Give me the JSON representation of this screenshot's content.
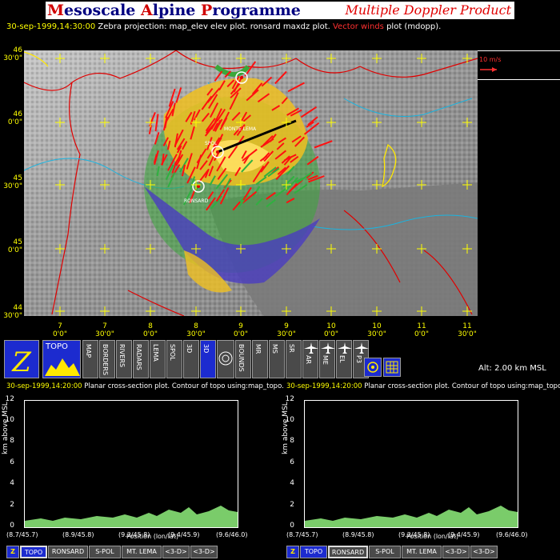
{
  "title": {
    "left_parts": [
      {
        "cap": "M",
        "rest": "esoscale "
      },
      {
        "cap": "A",
        "rest": "lpine "
      },
      {
        "cap": "P",
        "rest": "rogramme"
      }
    ],
    "right": "Multiple Doppler Product"
  },
  "info": {
    "datetime": "30-sep-1999,14:30:00",
    "prefix": "Zebra projection: map_elev elev plot. ronsard maxdz plot. ",
    "vector": "Vector winds",
    "suffix": " plot (mdopp)."
  },
  "map": {
    "wind_scale_label": "10 m/s",
    "left_ticks": [
      {
        "deg": "46",
        "min": "30'0\""
      },
      {
        "deg": "46",
        "min": "0'0\""
      },
      {
        "deg": "45",
        "min": "30'0\""
      },
      {
        "deg": "45",
        "min": "0'0\""
      },
      {
        "deg": "44",
        "min": "30'0\""
      }
    ],
    "bottom_ticks": [
      {
        "deg": "7",
        "min": "0'0\""
      },
      {
        "deg": "7",
        "min": "30'0\""
      },
      {
        "deg": "8",
        "min": "0'0\""
      },
      {
        "deg": "8",
        "min": "30'0\""
      },
      {
        "deg": "9",
        "min": "0'0\""
      },
      {
        "deg": "9",
        "min": "30'0\""
      },
      {
        "deg": "10",
        "min": "0'0\""
      },
      {
        "deg": "10",
        "min": "30'0\""
      },
      {
        "deg": "11",
        "min": "0'0\""
      },
      {
        "deg": "11",
        "min": "30'0\""
      }
    ],
    "radar_labels": [
      "SPOL",
      "MONTE LEMA",
      "RONSARD"
    ],
    "colors": {
      "terrain": "#8c8c8c",
      "border": "#e00000",
      "water": "#1ab4e0",
      "lake": "#ffe800",
      "wind": "#ff0000"
    }
  },
  "toolbar": {
    "z_label": "Z",
    "topo_label": "TOPO",
    "items": [
      "MAP",
      "BORDERS",
      "RIVERS",
      "RADARS",
      "LEMA",
      "SPOL",
      "3D",
      "3D",
      "",
      "BOUNDS",
      "MR",
      "MS",
      "SR",
      "AR",
      "ME",
      "EL",
      "P3"
    ],
    "altitude": "Alt: 2.00 km MSL"
  },
  "panels": [
    {
      "datetime": "30-sep-1999,14:20:00",
      "desc": " Planar cross-section plot. Contour of topo using:map_topo.",
      "ylabel": "km above MSL",
      "xlabel": "Position (lon/lat)",
      "yticks": [
        "12",
        "10",
        "8",
        "6",
        "4",
        "2",
        "0"
      ],
      "xticks": [
        "(8.7/45.7)",
        "(8.9/45.8)",
        "(9.2/45.8)",
        "(9.4/45.9)",
        "(9.6/46.0)"
      ],
      "buttons": [
        "Z",
        "TOPO",
        "RONSARD",
        "S-POL",
        "MT. LEMA",
        "<3-D>",
        "<3-D>"
      ],
      "active": 1
    },
    {
      "datetime": "30-sep-1999,14:20:00",
      "desc": " Planar cross-section plot. Contour of topo using:map_topo.",
      "ylabel": "km above MSL",
      "xlabel": "Position (lon/lat)",
      "yticks": [
        "12",
        "10",
        "8",
        "6",
        "4",
        "2",
        "0"
      ],
      "xticks": [
        "(8.7/45.7)",
        "(8.9/45.8)",
        "(9.2/45.8)",
        "(9.4/45.9)",
        "(9.6/46.0)"
      ],
      "buttons": [
        "Z",
        "TOPO",
        "RONSARD",
        "S-POL",
        "MT. LEMA",
        "<3-D>",
        "<3-D>"
      ],
      "active": 2
    }
  ]
}
